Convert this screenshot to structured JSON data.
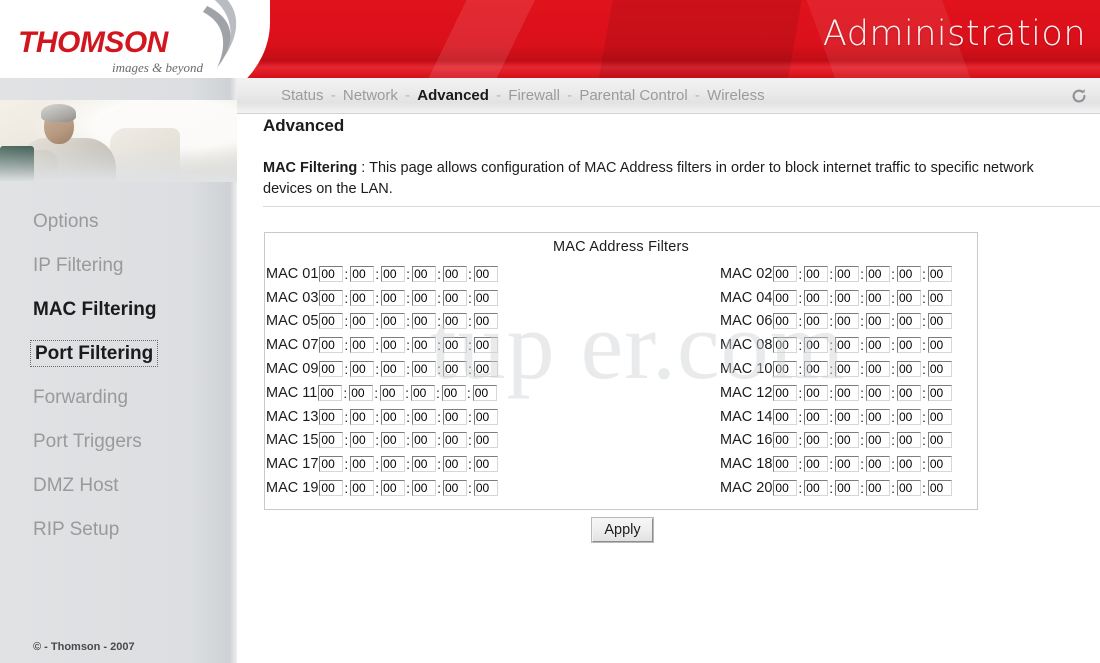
{
  "header": {
    "logo_word": "THOMSON",
    "logo_tagline": "images & beyond",
    "section_title": "Administration",
    "brand_red": "#d9101a"
  },
  "nav": {
    "separator": "-",
    "items": [
      {
        "label": "Status",
        "active": false
      },
      {
        "label": "Network",
        "active": false
      },
      {
        "label": "Advanced",
        "active": true
      },
      {
        "label": "Firewall",
        "active": false
      },
      {
        "label": "Parental Control",
        "active": false
      },
      {
        "label": "Wireless",
        "active": false
      }
    ],
    "refresh_icon": "refresh-icon"
  },
  "sidebar": {
    "items": [
      {
        "label": "Options",
        "state": "normal"
      },
      {
        "label": "IP Filtering",
        "state": "normal"
      },
      {
        "label": "MAC Filtering",
        "state": "active"
      },
      {
        "label": "Port Filtering",
        "state": "focused"
      },
      {
        "label": "Forwarding",
        "state": "normal"
      },
      {
        "label": "Port Triggers",
        "state": "normal"
      },
      {
        "label": "DMZ Host",
        "state": "normal"
      },
      {
        "label": "RIP Setup",
        "state": "normal"
      }
    ],
    "copyright": "© - Thomson - 2007"
  },
  "main": {
    "title": "Advanced",
    "desc_label": "MAC Filtering",
    "desc_separator": ":",
    "desc_text": "This page allows configuration of MAC Address filters in order to block internet traffic to specific network devices on the LAN.",
    "table_title": "MAC Address Filters",
    "apply_label": "Apply",
    "octet_default": "00",
    "octet_separator": ":",
    "rows": [
      {
        "left_label": "MAC 01",
        "left_value": [
          "00",
          "00",
          "00",
          "00",
          "00",
          "00"
        ],
        "right_label": "MAC 02",
        "right_value": [
          "00",
          "00",
          "00",
          "00",
          "00",
          "00"
        ]
      },
      {
        "left_label": "MAC 03",
        "left_value": [
          "00",
          "00",
          "00",
          "00",
          "00",
          "00"
        ],
        "right_label": "MAC 04",
        "right_value": [
          "00",
          "00",
          "00",
          "00",
          "00",
          "00"
        ]
      },
      {
        "left_label": "MAC 05",
        "left_value": [
          "00",
          "00",
          "00",
          "00",
          "00",
          "00"
        ],
        "right_label": "MAC 06",
        "right_value": [
          "00",
          "00",
          "00",
          "00",
          "00",
          "00"
        ]
      },
      {
        "left_label": "MAC 07",
        "left_value": [
          "00",
          "00",
          "00",
          "00",
          "00",
          "00"
        ],
        "right_label": "MAC 08",
        "right_value": [
          "00",
          "00",
          "00",
          "00",
          "00",
          "00"
        ]
      },
      {
        "left_label": "MAC 09",
        "left_value": [
          "00",
          "00",
          "00",
          "00",
          "00",
          "00"
        ],
        "right_label": "MAC 10",
        "right_value": [
          "00",
          "00",
          "00",
          "00",
          "00",
          "00"
        ]
      },
      {
        "left_label": "MAC 11",
        "left_value": [
          "00",
          "00",
          "00",
          "00",
          "00",
          "00"
        ],
        "right_label": "MAC 12",
        "right_value": [
          "00",
          "00",
          "00",
          "00",
          "00",
          "00"
        ]
      },
      {
        "left_label": "MAC 13",
        "left_value": [
          "00",
          "00",
          "00",
          "00",
          "00",
          "00"
        ],
        "right_label": "MAC 14",
        "right_value": [
          "00",
          "00",
          "00",
          "00",
          "00",
          "00"
        ]
      },
      {
        "left_label": "MAC 15",
        "left_value": [
          "00",
          "00",
          "00",
          "00",
          "00",
          "00"
        ],
        "right_label": "MAC 16",
        "right_value": [
          "00",
          "00",
          "00",
          "00",
          "00",
          "00"
        ]
      },
      {
        "left_label": "MAC 17",
        "left_value": [
          "00",
          "00",
          "00",
          "00",
          "00",
          "00"
        ],
        "right_label": "MAC 18",
        "right_value": [
          "00",
          "00",
          "00",
          "00",
          "00",
          "00"
        ]
      },
      {
        "left_label": "MAC 19",
        "left_value": [
          "00",
          "00",
          "00",
          "00",
          "00",
          "00"
        ],
        "right_label": "MAC 20",
        "right_value": [
          "00",
          "00",
          "00",
          "00",
          "00",
          "00"
        ]
      }
    ]
  },
  "watermark": {
    "text": "tup        er.com"
  }
}
